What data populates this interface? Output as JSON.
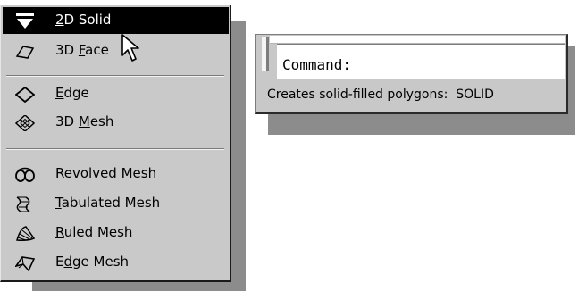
{
  "menu": {
    "items": [
      {
        "label_prefix": "",
        "label_mnemonic": "2",
        "label_rest": "D Solid",
        "icon": "2d-solid-icon"
      },
      {
        "label_prefix": "3D ",
        "label_mnemonic": "F",
        "label_rest": "ace",
        "icon": "3d-face-icon"
      },
      {
        "label_prefix": "",
        "label_mnemonic": "E",
        "label_rest": "dge",
        "icon": "edge-icon"
      },
      {
        "label_prefix": "3D ",
        "label_mnemonic": "M",
        "label_rest": "esh",
        "icon": "3d-mesh-icon"
      },
      {
        "label_prefix": "Revolved ",
        "label_mnemonic": "M",
        "label_rest": "esh",
        "icon": "revolved-mesh-icon"
      },
      {
        "label_prefix": "",
        "label_mnemonic": "T",
        "label_rest": "abulated Mesh",
        "icon": "tabulated-mesh-icon"
      },
      {
        "label_prefix": "",
        "label_mnemonic": "R",
        "label_rest": "uled Mesh",
        "icon": "ruled-mesh-icon"
      },
      {
        "label_prefix": "E",
        "label_mnemonic": "d",
        "label_rest": "ge Mesh",
        "icon": "edge-mesh-icon"
      }
    ],
    "highlighted": "2D Solid"
  },
  "command_window": {
    "prompt": "Command:",
    "status": "Creates solid-filled polygons:  SOLID"
  }
}
